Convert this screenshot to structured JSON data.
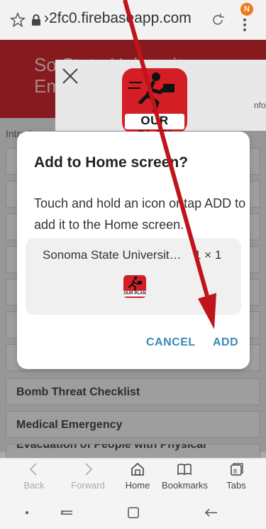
{
  "browser": {
    "url": "›2fc0.firebaseapp.com",
    "notification_badge": "N"
  },
  "background_page": {
    "header_line1": "So                State University",
    "header_line2": "Em",
    "header_suffix": "nfo",
    "intro_text": "Introdu",
    "list_items": [
      "Bomb Threat Checklist",
      "Medical Emergency",
      "Evacuation of People with Physical"
    ]
  },
  "app_icon": {
    "label": "OUR PLAN"
  },
  "dialog": {
    "title": "Add to Home screen?",
    "message": "Touch and hold an icon or tap ADD to add it to the Home screen.",
    "app_name": "Sonoma State Universit…",
    "app_size": "1 × 1",
    "cancel_label": "CANCEL",
    "add_label": "ADD"
  },
  "toolbar": {
    "back_label": "Back",
    "forward_label": "Forward",
    "home_label": "Home",
    "bookmarks_label": "Bookmarks",
    "tabs_label": "Tabs",
    "tabs_count": "8"
  },
  "colors": {
    "header_red": "#c9282e",
    "accent_blue": "#3a8ab3",
    "annotation_arrow": "#c0141b",
    "badge_orange": "#f07b18"
  }
}
